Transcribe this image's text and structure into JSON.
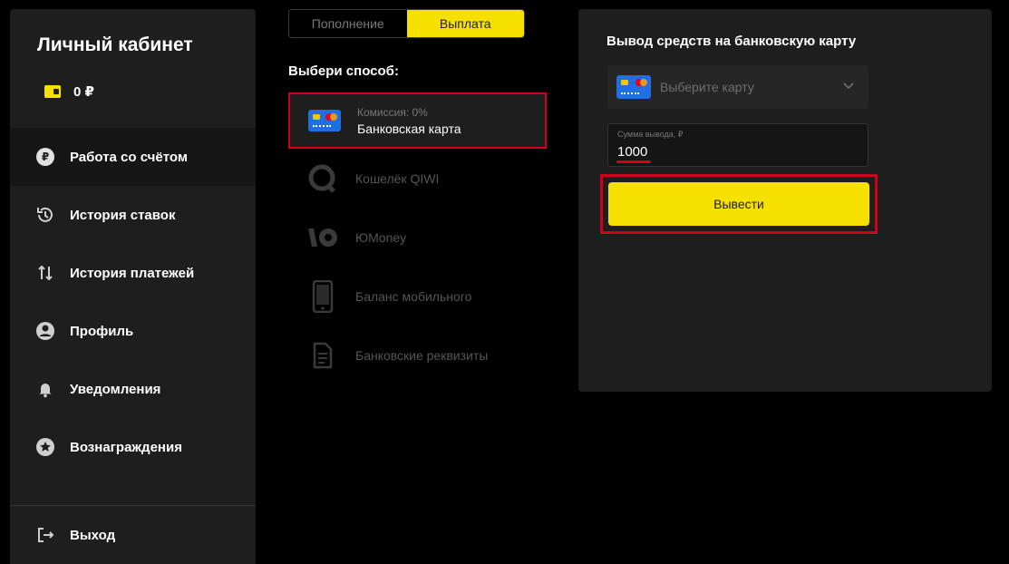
{
  "sidebar": {
    "title": "Личный кабинет",
    "balance": "0 ₽",
    "items": [
      {
        "label": "Работа со счётом",
        "icon": "ruble-icon"
      },
      {
        "label": "История ставок",
        "icon": "history-icon"
      },
      {
        "label": "История платежей",
        "icon": "transfer-arrows-icon"
      },
      {
        "label": "Профиль",
        "icon": "user-icon"
      },
      {
        "label": "Уведомления",
        "icon": "bell-icon"
      },
      {
        "label": "Вознаграждения",
        "icon": "star-icon"
      }
    ],
    "logout": "Выход"
  },
  "tabs": {
    "deposit": "Пополнение",
    "payout": "Выплата"
  },
  "methods": {
    "title": "Выбери способ:",
    "card_commission": "Комиссия: 0%",
    "card": "Банковская карта",
    "qiwi": "Кошелёк QIWI",
    "yoomoney": "ЮMoney",
    "mobile": "Баланс мобильного",
    "bank_details": "Банковские реквизиты"
  },
  "panel": {
    "title": "Вывод средств на банковскую карту",
    "select_placeholder": "Выберите карту",
    "amount_label": "Сумма вывода, ₽",
    "amount_value": "1000",
    "submit": "Вывести"
  },
  "colors": {
    "accent": "#f5e000",
    "highlight": "#d0021b",
    "panel_bg": "#1e1e1e"
  }
}
